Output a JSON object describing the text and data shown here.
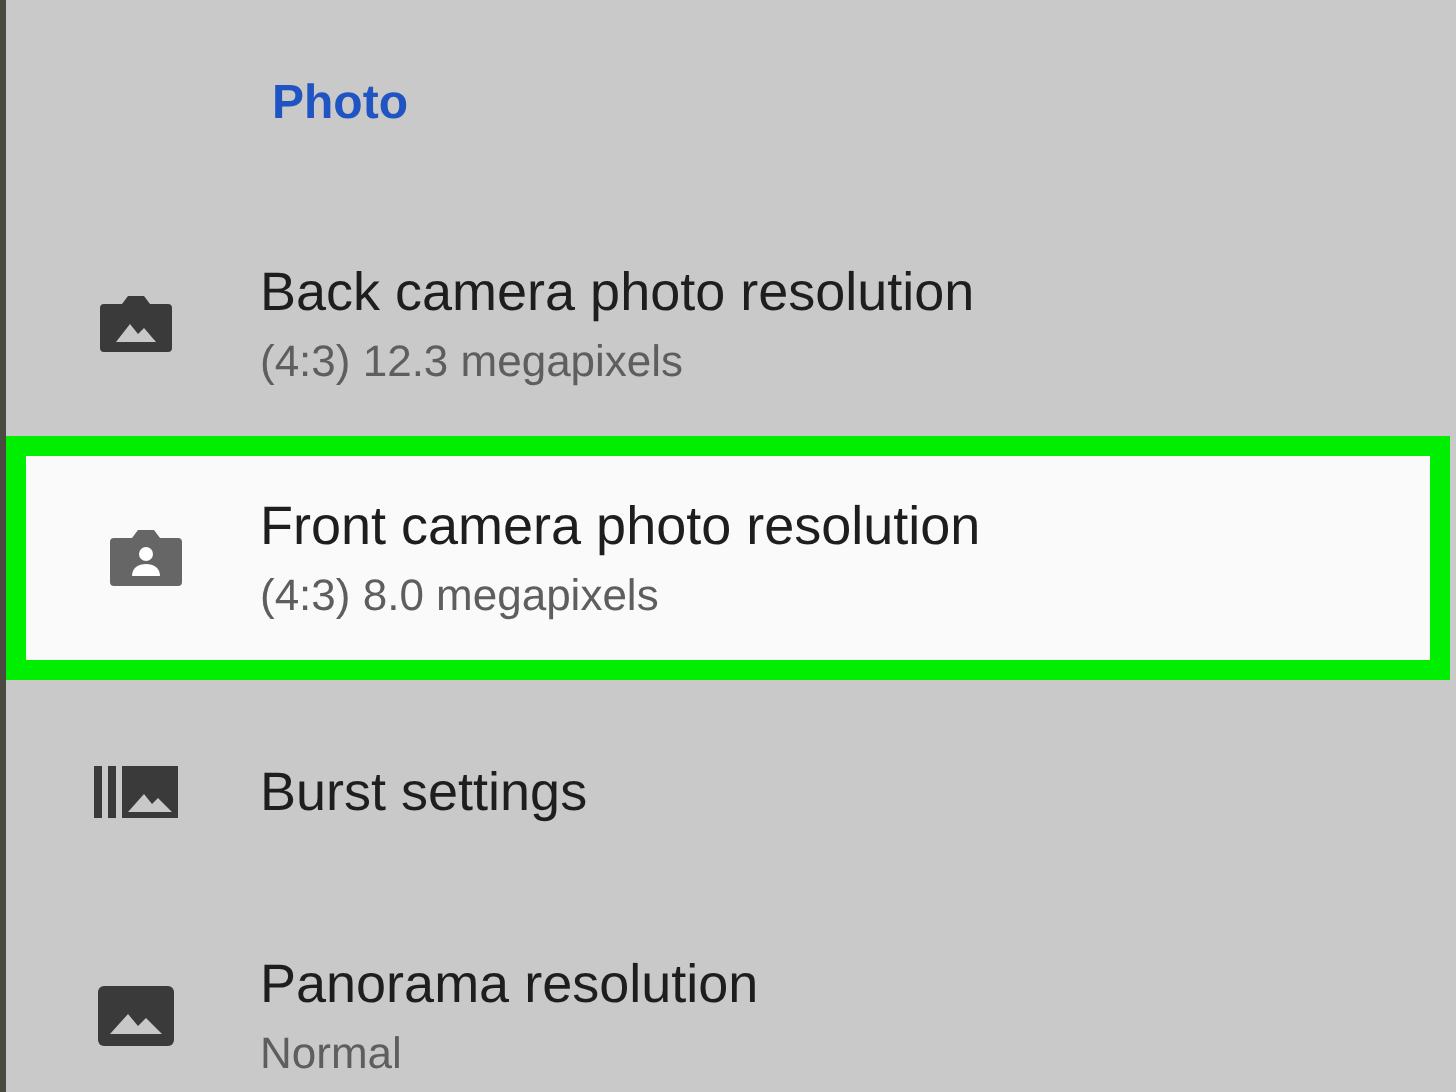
{
  "section": {
    "title": "Photo"
  },
  "items": [
    {
      "kind": "camera",
      "title": "Back camera photo resolution",
      "subtitle": "(4:3) 12.3 megapixels",
      "highlighted": false
    },
    {
      "kind": "front-camera",
      "title": "Front camera photo resolution",
      "subtitle": "(4:3) 8.0 megapixels",
      "highlighted": true
    },
    {
      "kind": "burst",
      "title": "Burst settings",
      "highlighted": false
    },
    {
      "kind": "image",
      "title": "Panorama resolution",
      "subtitle": "Normal",
      "highlighted": false
    }
  ]
}
